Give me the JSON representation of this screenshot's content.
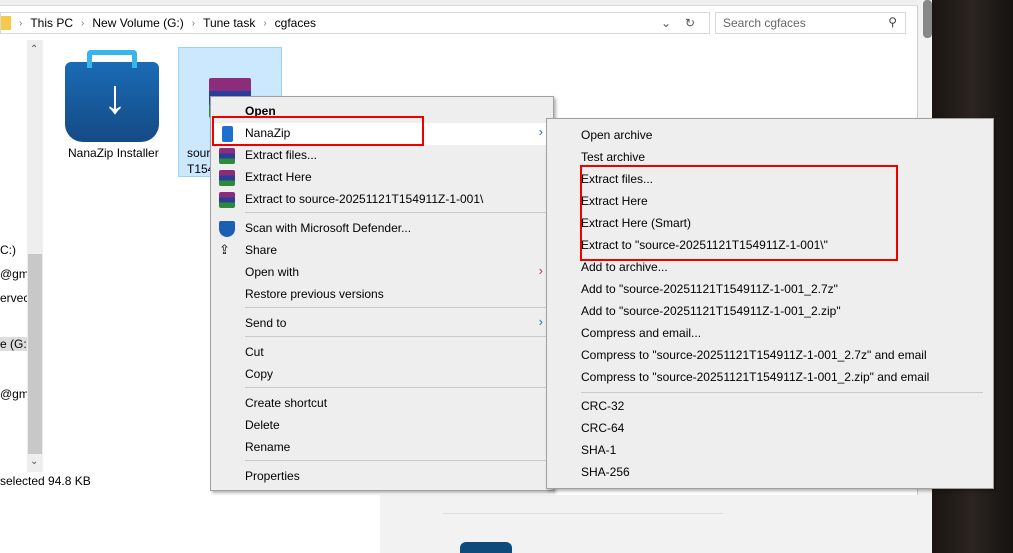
{
  "explorer": {
    "breadcrumb": [
      "This PC",
      "New Volume (G:)",
      "Tune task",
      "cgfaces"
    ],
    "search_placeholder": "Search cgfaces",
    "nav_fragments": [
      "C:)",
      "@gma",
      "ervec",
      "e (G:)",
      "@gma"
    ],
    "files": [
      {
        "name": "NanaZip Installer"
      },
      {
        "name_line1": "sour",
        "name_line2": "T154"
      }
    ],
    "status": "selected  94.8 KB"
  },
  "context_menu": {
    "items": [
      {
        "label": "Open"
      },
      {
        "label": "NanaZip"
      },
      {
        "label": "Extract files..."
      },
      {
        "label": "Extract Here"
      },
      {
        "label": "Extract to source-20251121T154911Z-1-001\\"
      },
      {
        "label": "Scan with Microsoft Defender..."
      },
      {
        "label": "Share"
      },
      {
        "label": "Open with"
      },
      {
        "label": "Restore previous versions"
      },
      {
        "label": "Send to"
      },
      {
        "label": "Cut"
      },
      {
        "label": "Copy"
      },
      {
        "label": "Create shortcut"
      },
      {
        "label": "Delete"
      },
      {
        "label": "Rename"
      },
      {
        "label": "Properties"
      }
    ]
  },
  "submenu": {
    "items": [
      {
        "label": "Open archive"
      },
      {
        "label": "Test archive"
      },
      {
        "label": "Extract files..."
      },
      {
        "label": "Extract Here"
      },
      {
        "label": "Extract Here (Smart)"
      },
      {
        "label": "Extract to \"source-20251121T154911Z-1-001\\\""
      },
      {
        "label": "Add to archive..."
      },
      {
        "label": "Add to \"source-20251121T154911Z-1-001_2.7z\""
      },
      {
        "label": "Add to \"source-20251121T154911Z-1-001_2.zip\""
      },
      {
        "label": "Compress and email..."
      },
      {
        "label": "Compress to \"source-20251121T154911Z-1-001_2.7z\" and email"
      },
      {
        "label": "Compress to \"source-20251121T154911Z-1-001_2.zip\" and email"
      },
      {
        "label": "CRC-32"
      },
      {
        "label": "CRC-64"
      },
      {
        "label": "SHA-1"
      },
      {
        "label": "SHA-256"
      }
    ]
  },
  "colors": {
    "highlight": "#e00000",
    "menu_bg": "#eeeeee",
    "selection": "#cce8ff"
  }
}
